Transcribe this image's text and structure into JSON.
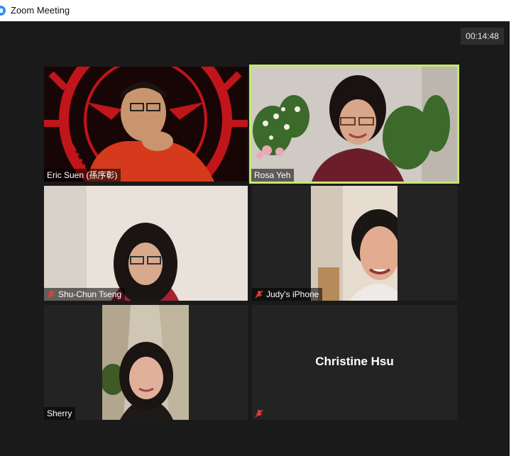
{
  "window": {
    "title": "Zoom Meeting",
    "app_icon": "zoom-camera-icon"
  },
  "meeting": {
    "timer": "00:14:48"
  },
  "participants": [
    {
      "name": "Eric Suen (孫序彰)",
      "muted": false,
      "active_speaker": false
    },
    {
      "name": "Rosa Yeh",
      "muted": false,
      "active_speaker": true
    },
    {
      "name": "Shu-Chun Tseng",
      "muted": true,
      "active_speaker": false
    },
    {
      "name": "Judy's iPhone",
      "muted": true,
      "active_speaker": false
    },
    {
      "name": "Sherry",
      "muted": false,
      "active_speaker": false
    },
    {
      "name": "Christine Hsu",
      "muted": true,
      "active_speaker": false,
      "video_off": true
    }
  ],
  "colors": {
    "active_border": "#c6e86a",
    "mute_icon": "#e0403a",
    "background": "#1a1a1a"
  }
}
